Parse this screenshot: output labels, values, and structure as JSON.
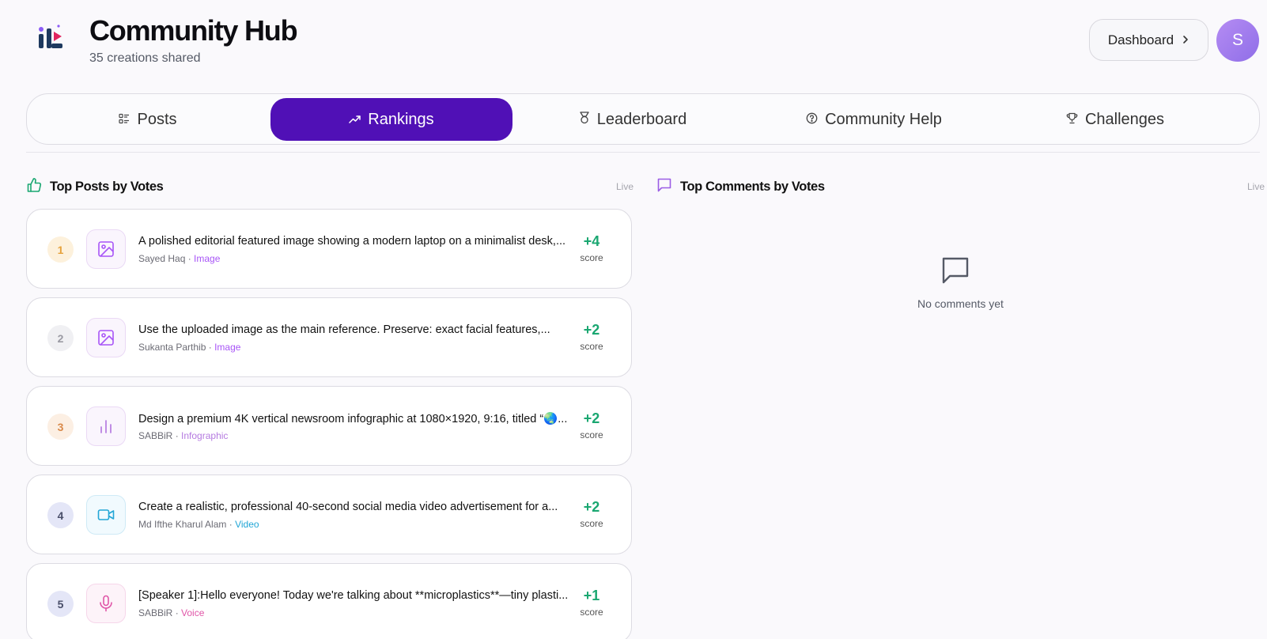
{
  "app": {
    "title": "Community Hub",
    "subtitle": "35 creations shared",
    "dashboard_label": "Dashboard",
    "avatar_initial": "S"
  },
  "tabs": [
    {
      "label": "Posts",
      "icon": "list-icon",
      "active": false
    },
    {
      "label": "Rankings",
      "icon": "trending-up-icon",
      "active": true
    },
    {
      "label": "Leaderboard",
      "icon": "medal-icon",
      "active": false
    },
    {
      "label": "Community Help",
      "icon": "help-circle-icon",
      "active": false
    },
    {
      "label": "Challenges",
      "icon": "trophy-icon",
      "active": false
    }
  ],
  "top_posts": {
    "title": "Top Posts by Votes",
    "status": "Live",
    "items": [
      {
        "rank": "1",
        "title": "A polished editorial featured image showing a modern laptop on a minimalist desk,...",
        "author": "Sayed Haq",
        "type": "Image",
        "score": "+4",
        "score_label": "score"
      },
      {
        "rank": "2",
        "title": "Use the uploaded image as the main reference. Preserve: exact facial features,...",
        "author": "Sukanta Parthib",
        "type": "Image",
        "score": "+2",
        "score_label": "score"
      },
      {
        "rank": "3",
        "title": "Design a premium 4K vertical newsroom infographic at 1080×1920, 9:16, titled “🌏...",
        "author": "SABBiR",
        "type": "Infographic",
        "score": "+2",
        "score_label": "score"
      },
      {
        "rank": "4",
        "title": "Create a realistic, professional 40-second social media video advertisement for a...",
        "author": "Md Ifthe Kharul Alam",
        "type": "Video",
        "score": "+2",
        "score_label": "score"
      },
      {
        "rank": "5",
        "title": "[Speaker 1]:Hello everyone! Today we're talking about **microplastics**—tiny plasti...",
        "author": "SABBiR",
        "type": "Voice",
        "score": "+1",
        "score_label": "score"
      }
    ]
  },
  "top_comments": {
    "title": "Top Comments by Votes",
    "status": "Live",
    "empty_text": "No comments yet"
  },
  "colors": {
    "accent": "#5010b6",
    "score_positive": "#1aa771",
    "image_type": "#a855f7",
    "infographic_type": "#b57be0",
    "video_type": "#22a6d6",
    "voice_type": "#e056a8"
  }
}
